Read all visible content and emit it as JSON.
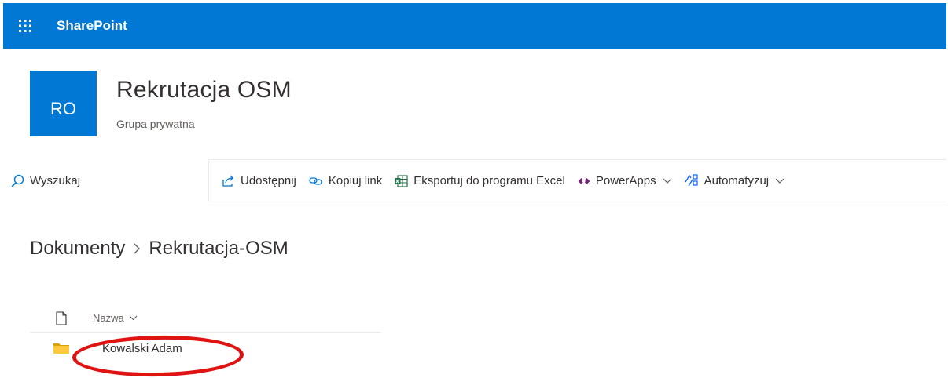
{
  "suitebar": {
    "app_name": "SharePoint",
    "color": "#0078d4"
  },
  "site": {
    "logo_initials": "RO",
    "title": "Rekrutacja OSM",
    "subtitle": "Grupa prywatna"
  },
  "search": {
    "placeholder": "Wyszukaj"
  },
  "commands": [
    {
      "label": "Udostępnij",
      "icon": "share-icon"
    },
    {
      "label": "Kopiuj link",
      "icon": "link-icon"
    },
    {
      "label": "Eksportuj do programu Excel",
      "icon": "excel-icon"
    },
    {
      "label": "PowerApps",
      "icon": "powerapps-icon",
      "has_menu": true
    },
    {
      "label": "Automatyzuj",
      "icon": "flow-icon",
      "has_menu": true
    }
  ],
  "breadcrumb": [
    "Dokumenty",
    "Rekrutacja-OSM"
  ],
  "list": {
    "column_name": "Nazwa",
    "rows": [
      {
        "name": "Kowalski Adam",
        "type": "folder",
        "icon": "folder-icon"
      }
    ]
  },
  "annotation_color": "#e01313"
}
